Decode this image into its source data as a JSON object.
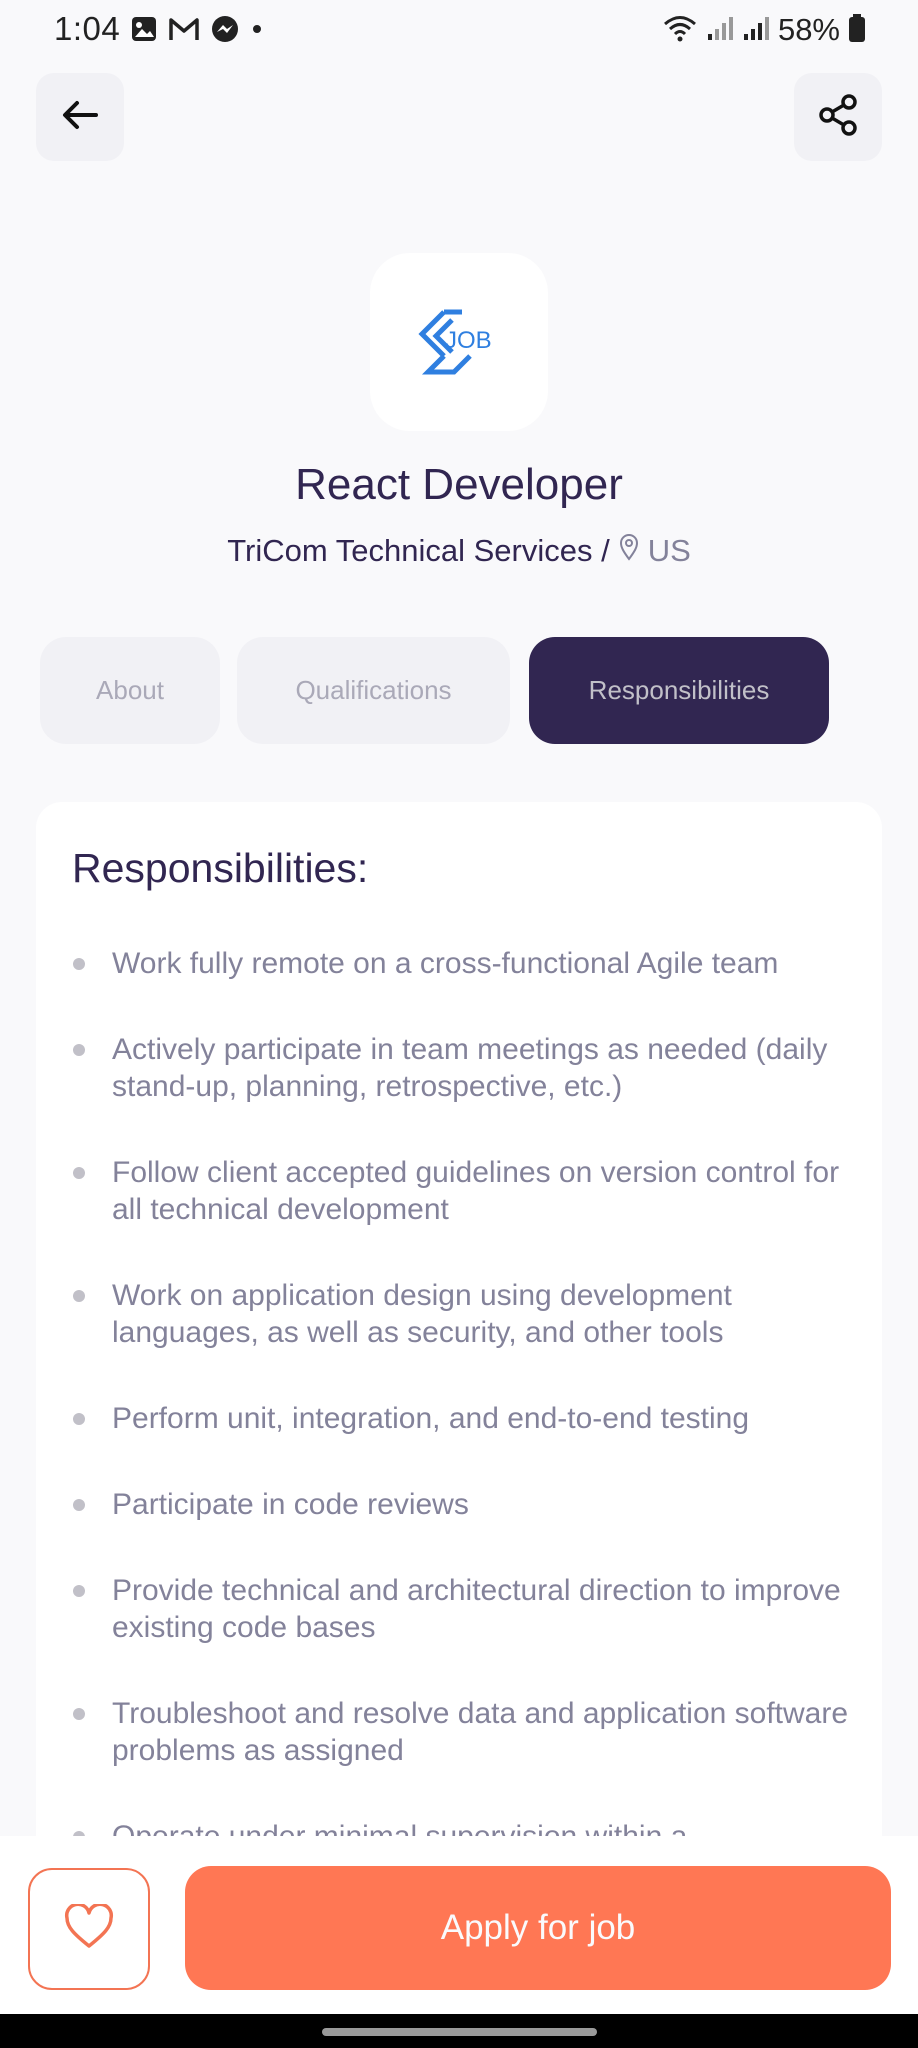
{
  "status_bar": {
    "time": "1:04",
    "battery_percent": "58%",
    "left_icons": [
      "gallery-icon",
      "gmail-icon",
      "messenger-icon",
      "dot-icon"
    ],
    "right_icons": [
      "wifi-icon",
      "signal-icon",
      "signal-icon",
      "battery-icon"
    ]
  },
  "header": {
    "back_icon": "arrow-left-icon",
    "share_icon": "share-icon"
  },
  "job": {
    "logo_text": "JOB",
    "title": "React Developer",
    "company": "TriCom Technical Services /",
    "location": "US"
  },
  "tabs": [
    {
      "label": "About",
      "active": false
    },
    {
      "label": "Qualifications",
      "active": false
    },
    {
      "label": "Responsibilities",
      "active": true
    }
  ],
  "responsibilities": {
    "heading": "Responsibilities:",
    "items": [
      "Work fully remote on a cross-functional Agile team",
      "Actively participate in team meetings as needed (daily stand-up, planning, retrospective, etc.)",
      "Follow client accepted guidelines on version control for all technical development",
      "Work on application design using development languages, as well as security, and other tools",
      "Perform unit, integration, and end-to-end testing",
      "Participate in code reviews",
      "Provide technical and architectural direction to improve existing code bases",
      "Troubleshoot and resolve data and application software problems as assigned",
      "Operate under minimal supervision within a"
    ]
  },
  "footer": {
    "like_icon": "heart-outline-icon",
    "apply_label": "Apply for job"
  },
  "colors": {
    "primary": "#312651",
    "tertiary": "#FF7754",
    "gray": "#83829A",
    "gray2": "#C1C0C8",
    "light": "#F1F1F5",
    "logo_blue": "#2f7fe0"
  }
}
